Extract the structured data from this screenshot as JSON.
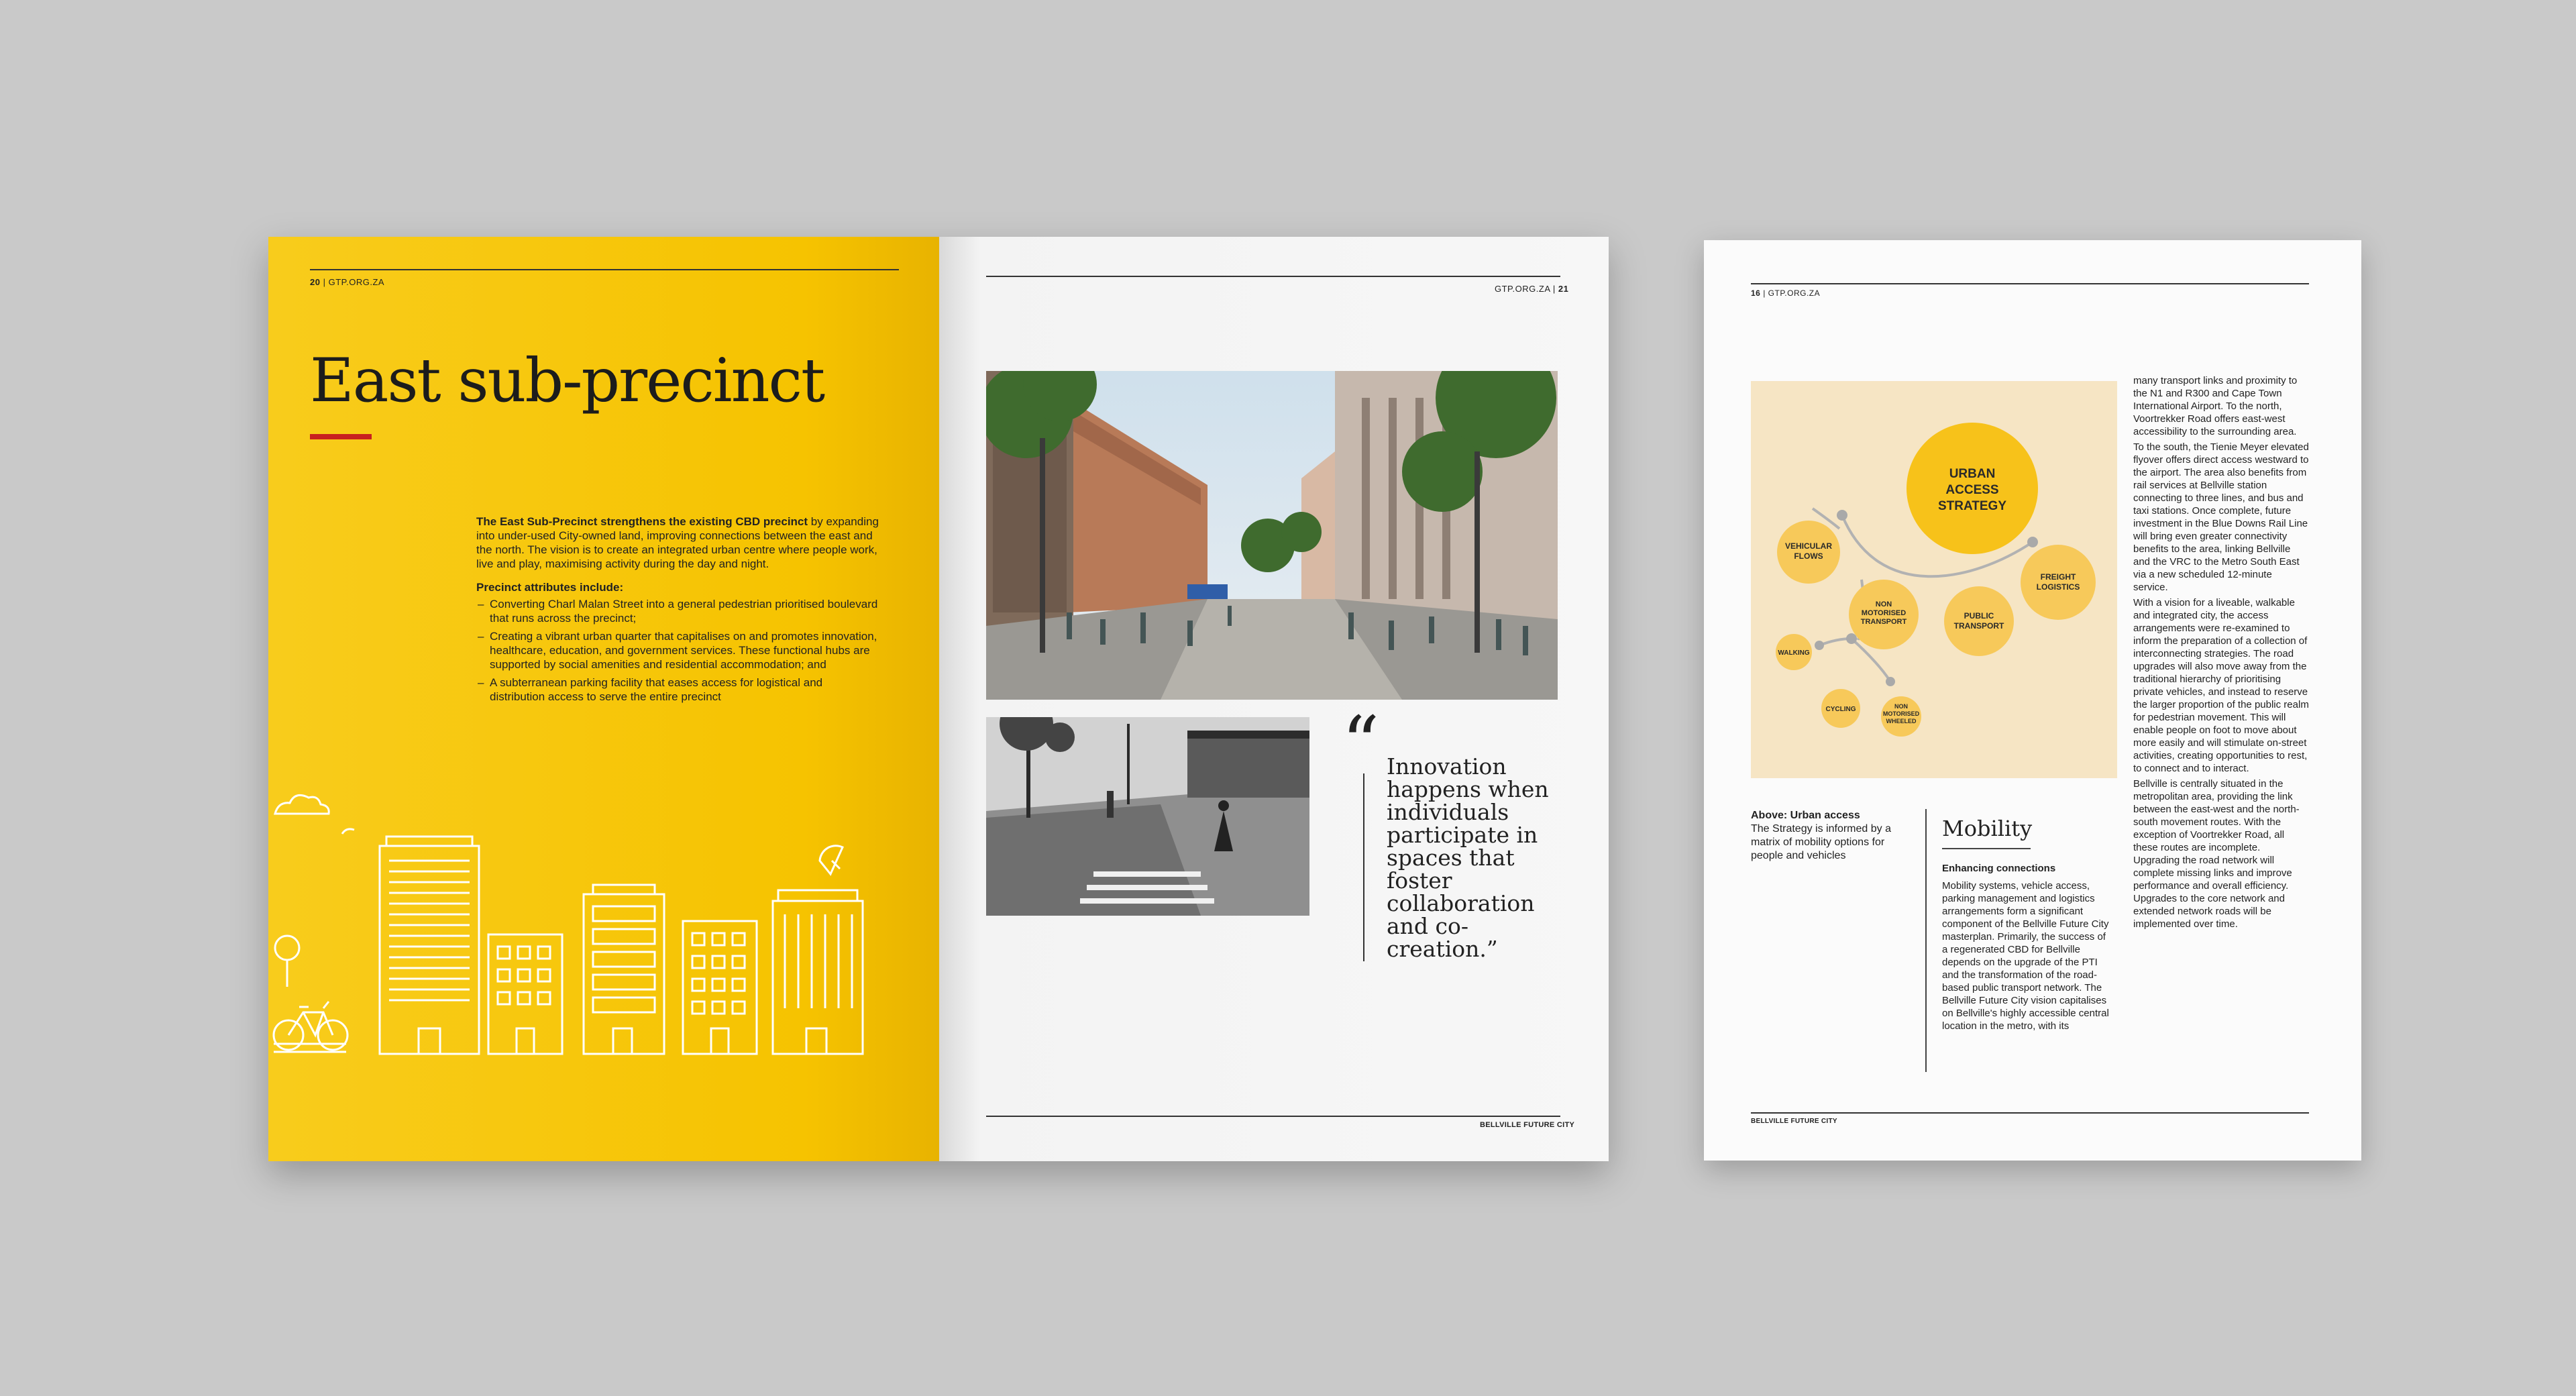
{
  "left_page": {
    "folio": "20",
    "site": "GTP.ORG.ZA",
    "title": "East sub-precinct",
    "lead_bold": "The East Sub-Precinct strengthens the existing CBD precinct",
    "lead_rest": " by expanding into under-used City-owned land, improving connections between the east and the north. The vision is to create an integrated urban centre where people work, live and play, maximising activity during the day and night.",
    "attributes_heading": "Precinct attributes include:",
    "attributes": [
      "Converting Charl Malan Street into a general pedestrian prioritised boulevard that runs across the precinct;",
      "Creating a vibrant urban quarter that capitalises on and promotes innovation, healthcare, education, and government services. These functional hubs are supported by social amenities and residential accommodation; and",
      "A subterranean parking facility that eases access for logistical and distribution access to serve the entire precinct"
    ]
  },
  "right_page": {
    "site": "GTP.ORG.ZA",
    "folio": "21",
    "quote_mark": "“",
    "quote": "Innovation happens when individuals participate in spaces that foster collaboration and co-creation.”",
    "footer": "BELLVILLE FUTURE CITY"
  },
  "single_page": {
    "folio": "16",
    "site": "GTP.ORG.ZA",
    "diagram": {
      "center": "URBAN ACCESS STRATEGY",
      "nodes": [
        "VEHICULAR FLOWS",
        "NON MOTORISED TRANSPORT",
        "PUBLIC TRANSPORT",
        "FREIGHT LOGISTICS",
        "WALKING",
        "CYCLING",
        "NON MOTORISED WHEELED"
      ]
    },
    "caption_title": "Above: Urban access",
    "caption_text": "The Strategy is informed by a matrix of mobility options for people and vehicles",
    "section_title": "Mobility",
    "subheading": "Enhancing connections",
    "mobility_text": "Mobility systems, vehicle access, parking management and logistics arrangements form a significant component of the Bellville Future City masterplan. Primarily, the success of a regenerated CBD for Bellville depends on the upgrade of the PTI and the transformation of the road-based public transport network. The Bellville Future City vision capitalises on Bellville's highly accessible central location in the metro, with its",
    "column_paragraphs": [
      "many transport links and proximity to the N1 and R300 and Cape Town International Airport. To the north, Voortrekker Road offers east-west accessibility to the surrounding area.",
      "To the south, the Tienie Meyer elevated flyover offers direct access westward to the airport. The area also benefits from rail services at Bellville station connecting to three lines, and bus and taxi stations. Once complete, future investment in the Blue Downs Rail Line will bring even greater connectivity benefits to the area, linking Bellville and the VRC to the Metro South East via a new scheduled 12-minute service.",
      "With a vision for a liveable, walkable and integrated city, the access arrangements were re-examined to inform the preparation of a collection of interconnecting strategies. The road upgrades will also move away from the traditional hierarchy of prioritising private vehicles, and instead to reserve the larger proportion of the public realm for pedestrian movement. This will enable people on foot to move about more easily and will stimulate on-street activities, creating opportunities to rest, to connect and to interact.",
      "Bellville is centrally situated in the metropolitan area, providing the link between the east-west and the north-south movement routes. With the exception of Voortrekker Road, all these routes are incomplete. Upgrading the road network will complete missing links and improve performance and overall efficiency. Upgrades to the core network and extended network roads will be implemented over time."
    ],
    "footer": "BELLVILLE FUTURE CITY"
  },
  "colors": {
    "yellow": "#f6c300",
    "red_accent": "#c8201f",
    "bubble_main": "#f7c21a",
    "bubble_light": "#f7c95a",
    "diagram_bg": "#f6e5c4"
  }
}
